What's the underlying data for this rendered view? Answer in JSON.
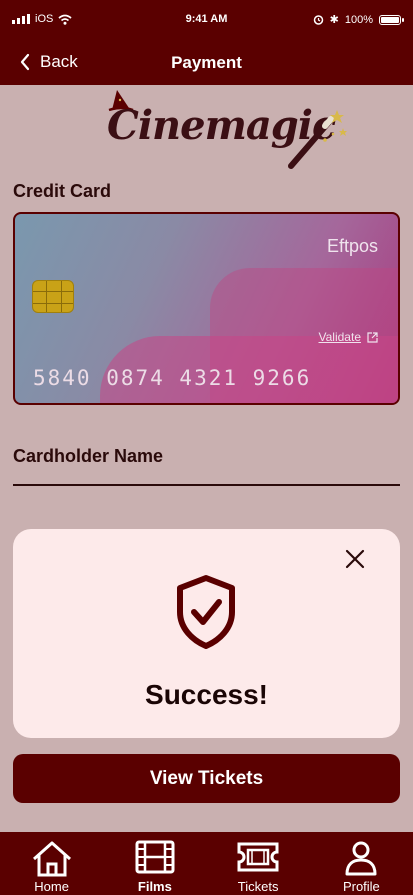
{
  "status": {
    "carrier": "iOS",
    "time": "9:41 AM",
    "battery": "100%"
  },
  "nav": {
    "back_label": "Back",
    "title": "Payment"
  },
  "logo": {
    "text": "Cinemagic"
  },
  "credit_card": {
    "section_label": "Credit Card",
    "brand": "Eftpos",
    "validate_label": "Validate",
    "number": "5840 0874 4321 9266"
  },
  "cardholder": {
    "label": "Cardholder Name"
  },
  "modal": {
    "title": "Success!"
  },
  "actions": {
    "view_tickets": "View Tickets"
  },
  "tabs": [
    {
      "label": "Home"
    },
    {
      "label": "Films"
    },
    {
      "label": "Tickets"
    },
    {
      "label": "Profile"
    }
  ],
  "colors": {
    "primary": "#5a0000",
    "background": "#c9b0b0",
    "modal": "#fdeaea"
  }
}
